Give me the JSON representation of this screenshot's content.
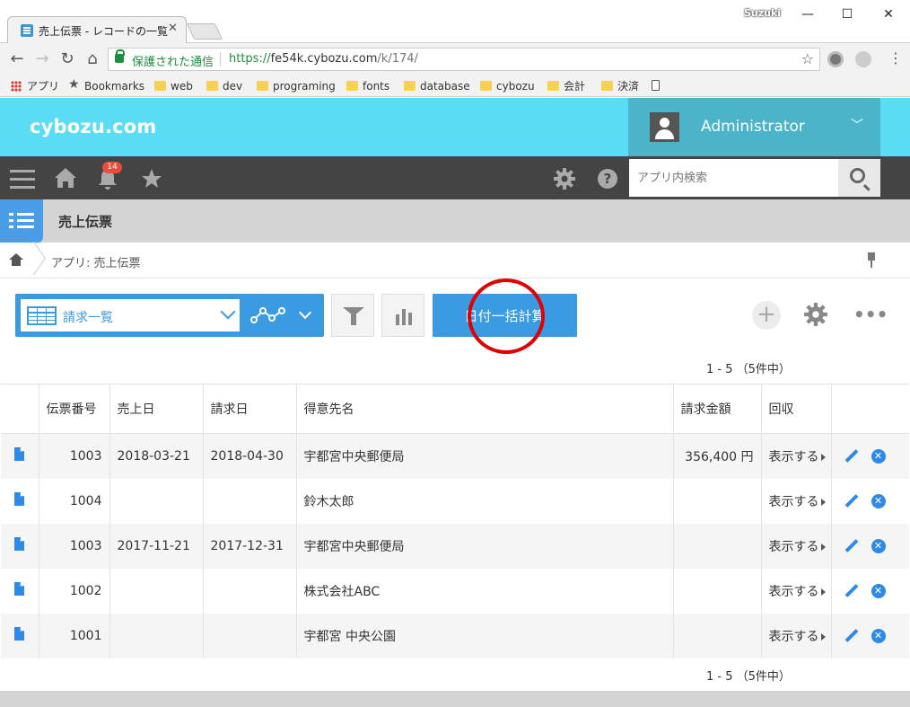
{
  "browser": {
    "tab_title": "売上伝票 - レコードの一覧",
    "tab_close": "✕",
    "profile_name": "Suzuki",
    "window_controls": [
      "—",
      "☐",
      "✕"
    ],
    "secure_label": "保護された通信",
    "url_scheme": "https://",
    "url_host": "fe54k.cybozu.com",
    "url_path": "/k/174/",
    "bookmarks": [
      "アプリ",
      "Bookmarks",
      "web",
      "dev",
      "programing",
      "fonts",
      "database",
      "cybozu",
      "会計",
      "決済"
    ]
  },
  "header": {
    "logo": "cybozu.com",
    "user_name": "Administrator"
  },
  "nav": {
    "notification_count": "14",
    "search_placeholder": "アプリ内検索"
  },
  "app": {
    "title": "売上伝票",
    "breadcrumb": "アプリ: 売上伝票"
  },
  "toolbar": {
    "view_name": "請求一覧",
    "date_calc_button": "日付一括計算",
    "add_label": "+"
  },
  "pager": {
    "text": "1 - 5 （5件中）"
  },
  "table": {
    "headers": [
      "伝票番号",
      "売上日",
      "請求日",
      "得意先名",
      "請求金額",
      "回収"
    ],
    "rows": [
      {
        "slip_no": "1003",
        "sale_date": "2018-03-21",
        "invoice_date": "2018-04-30",
        "customer": "宇都宮中央郵便局",
        "amount": "356,400 円",
        "collect": "表示する"
      },
      {
        "slip_no": "1004",
        "sale_date": "",
        "invoice_date": "",
        "customer": "鈴木太郎",
        "amount": "",
        "collect": "表示する"
      },
      {
        "slip_no": "1003",
        "sale_date": "2017-11-21",
        "invoice_date": "2017-12-31",
        "customer": "宇都宮中央郵便局",
        "amount": "",
        "collect": "表示する"
      },
      {
        "slip_no": "1002",
        "sale_date": "",
        "invoice_date": "",
        "customer": "株式会社ABC",
        "amount": "",
        "collect": "表示する"
      },
      {
        "slip_no": "1001",
        "sale_date": "",
        "invoice_date": "",
        "customer": "宇都宮 中央公園",
        "amount": "",
        "collect": "表示する"
      }
    ]
  },
  "colors": {
    "header_cyan": "#5bdcf5",
    "accent_blue": "#3a9ae2",
    "annotation_red": "#e00000"
  }
}
